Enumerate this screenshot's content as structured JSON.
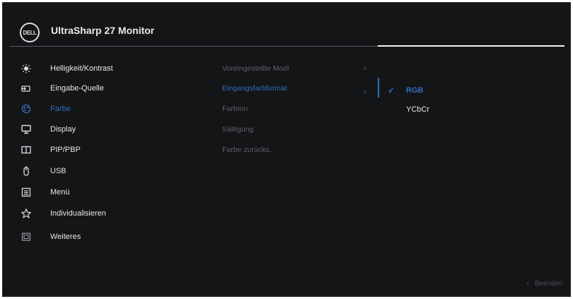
{
  "header": {
    "logo_text": "DELL",
    "title": "UltraSharp 27 Monitor"
  },
  "menu": [
    {
      "label": "Helligkeit/Kontrast",
      "icon": "brightness-icon",
      "active": false
    },
    {
      "label": "Eingabe-Quelle",
      "icon": "input-source-icon",
      "active": false
    },
    {
      "label": "Farbe",
      "icon": "color-icon",
      "active": true
    },
    {
      "label": "Display",
      "icon": "display-icon",
      "active": false
    },
    {
      "label": "PIP/PBP",
      "icon": "pip-icon",
      "active": false
    },
    {
      "label": "USB",
      "icon": "usb-icon",
      "active": false
    },
    {
      "label": "Menü",
      "icon": "menu-icon",
      "active": false
    },
    {
      "label": "Individualisieren",
      "icon": "star-icon",
      "active": false
    },
    {
      "label": "Weiteres",
      "icon": "others-icon",
      "active": false
    }
  ],
  "submenu": [
    {
      "label": "Voreingestellte Modi",
      "has_chevron": true,
      "active": false
    },
    {
      "label": "Eingangsfarbformat",
      "has_chevron": true,
      "active": true
    },
    {
      "label": "Farbton",
      "has_chevron": false,
      "active": false
    },
    {
      "label": "Sättigung",
      "has_chevron": false,
      "active": false
    },
    {
      "label": "Farbe zurücks.",
      "has_chevron": false,
      "active": false
    }
  ],
  "options": [
    {
      "label": "RGB",
      "selected": true
    },
    {
      "label": "YCbCr",
      "selected": false
    }
  ],
  "footer": {
    "exit_label": "Beenden"
  },
  "colors": {
    "accent": "#2f6fbf",
    "background": "#141517",
    "text": "#e6e7e9",
    "dim_text": "#5e6066"
  }
}
